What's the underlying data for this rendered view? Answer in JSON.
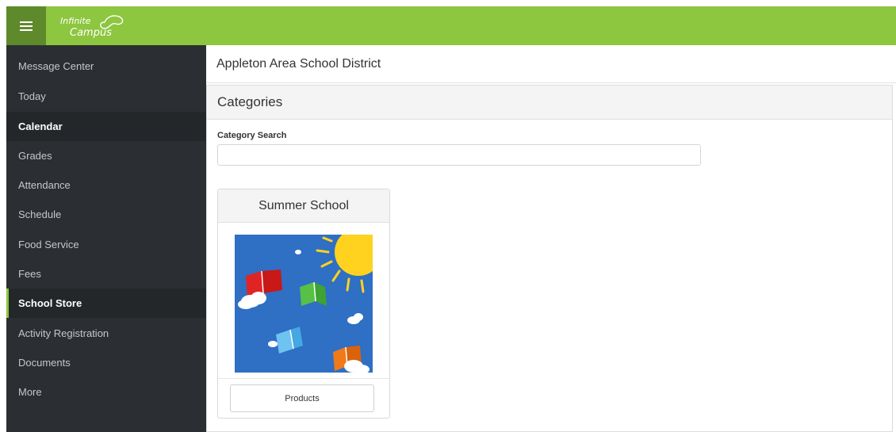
{
  "header": {
    "menu_icon": "hamburger-icon",
    "logo_line1": "Infinite",
    "logo_line2": "Campus",
    "brand_color": "#8dc63f"
  },
  "sidebar": {
    "items": [
      {
        "label": "Message Center"
      },
      {
        "label": "Today"
      },
      {
        "label": "Calendar"
      },
      {
        "label": "Grades"
      },
      {
        "label": "Attendance"
      },
      {
        "label": "Schedule"
      },
      {
        "label": "Food Service"
      },
      {
        "label": "Fees"
      },
      {
        "label": "School Store"
      },
      {
        "label": "Activity Registration"
      },
      {
        "label": "Documents"
      },
      {
        "label": "More"
      }
    ]
  },
  "main": {
    "district_name": "Appleton Area School District",
    "panel_title": "Categories",
    "search": {
      "label": "Category Search",
      "value": "",
      "placeholder": ""
    },
    "categories": [
      {
        "title": "Summer School",
        "image": "summer-school-books-sun-illustration",
        "button_label": "Products"
      }
    ]
  }
}
